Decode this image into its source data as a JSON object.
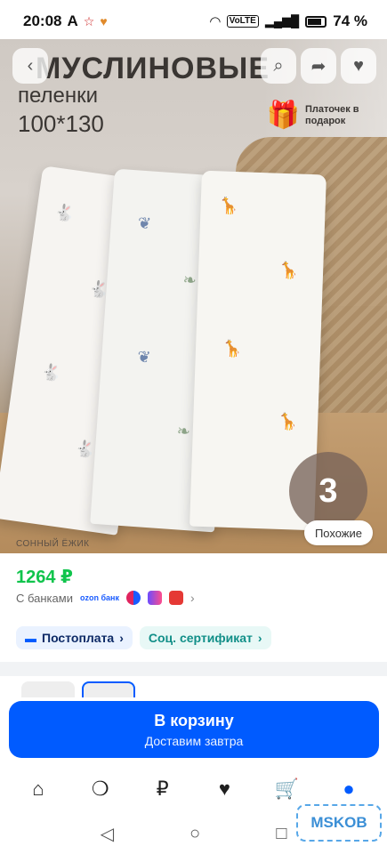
{
  "status": {
    "time": "20:08",
    "left_glyphs": [
      "A",
      "☆",
      "♥"
    ],
    "signal_label": "VoLTE",
    "battery": "74 %"
  },
  "hero": {
    "title": "МУСЛИНОВЫЕ",
    "subtitle": "пеленки",
    "size": "100*130",
    "gift": "Платочек в подарок",
    "count": "3",
    "brand": "СОННЫЙ ЁЖИК",
    "similar": "Похожие",
    "buttons": {
      "back": "chevron-left-icon",
      "search": "search-icon",
      "share": "share-icon",
      "favorite": "heart-icon"
    }
  },
  "product": {
    "price": "1264 ₽",
    "banks_label": "С банками",
    "ozon_bank": "ozon банк",
    "chips": [
      {
        "label": "Постоплата"
      },
      {
        "label": "Соц. сертификат"
      }
    ]
  },
  "cart": {
    "title": "В корзину",
    "subtitle": "Доставим завтра"
  },
  "tabs": [
    "home-icon",
    "fresh-icon",
    "ruble-icon",
    "favorites-icon",
    "cart-icon",
    "profile-icon"
  ],
  "watermark": "MSKOB",
  "colors": {
    "accent": "#005bff",
    "price": "#10c44c",
    "chip_teal": "#118f88"
  }
}
